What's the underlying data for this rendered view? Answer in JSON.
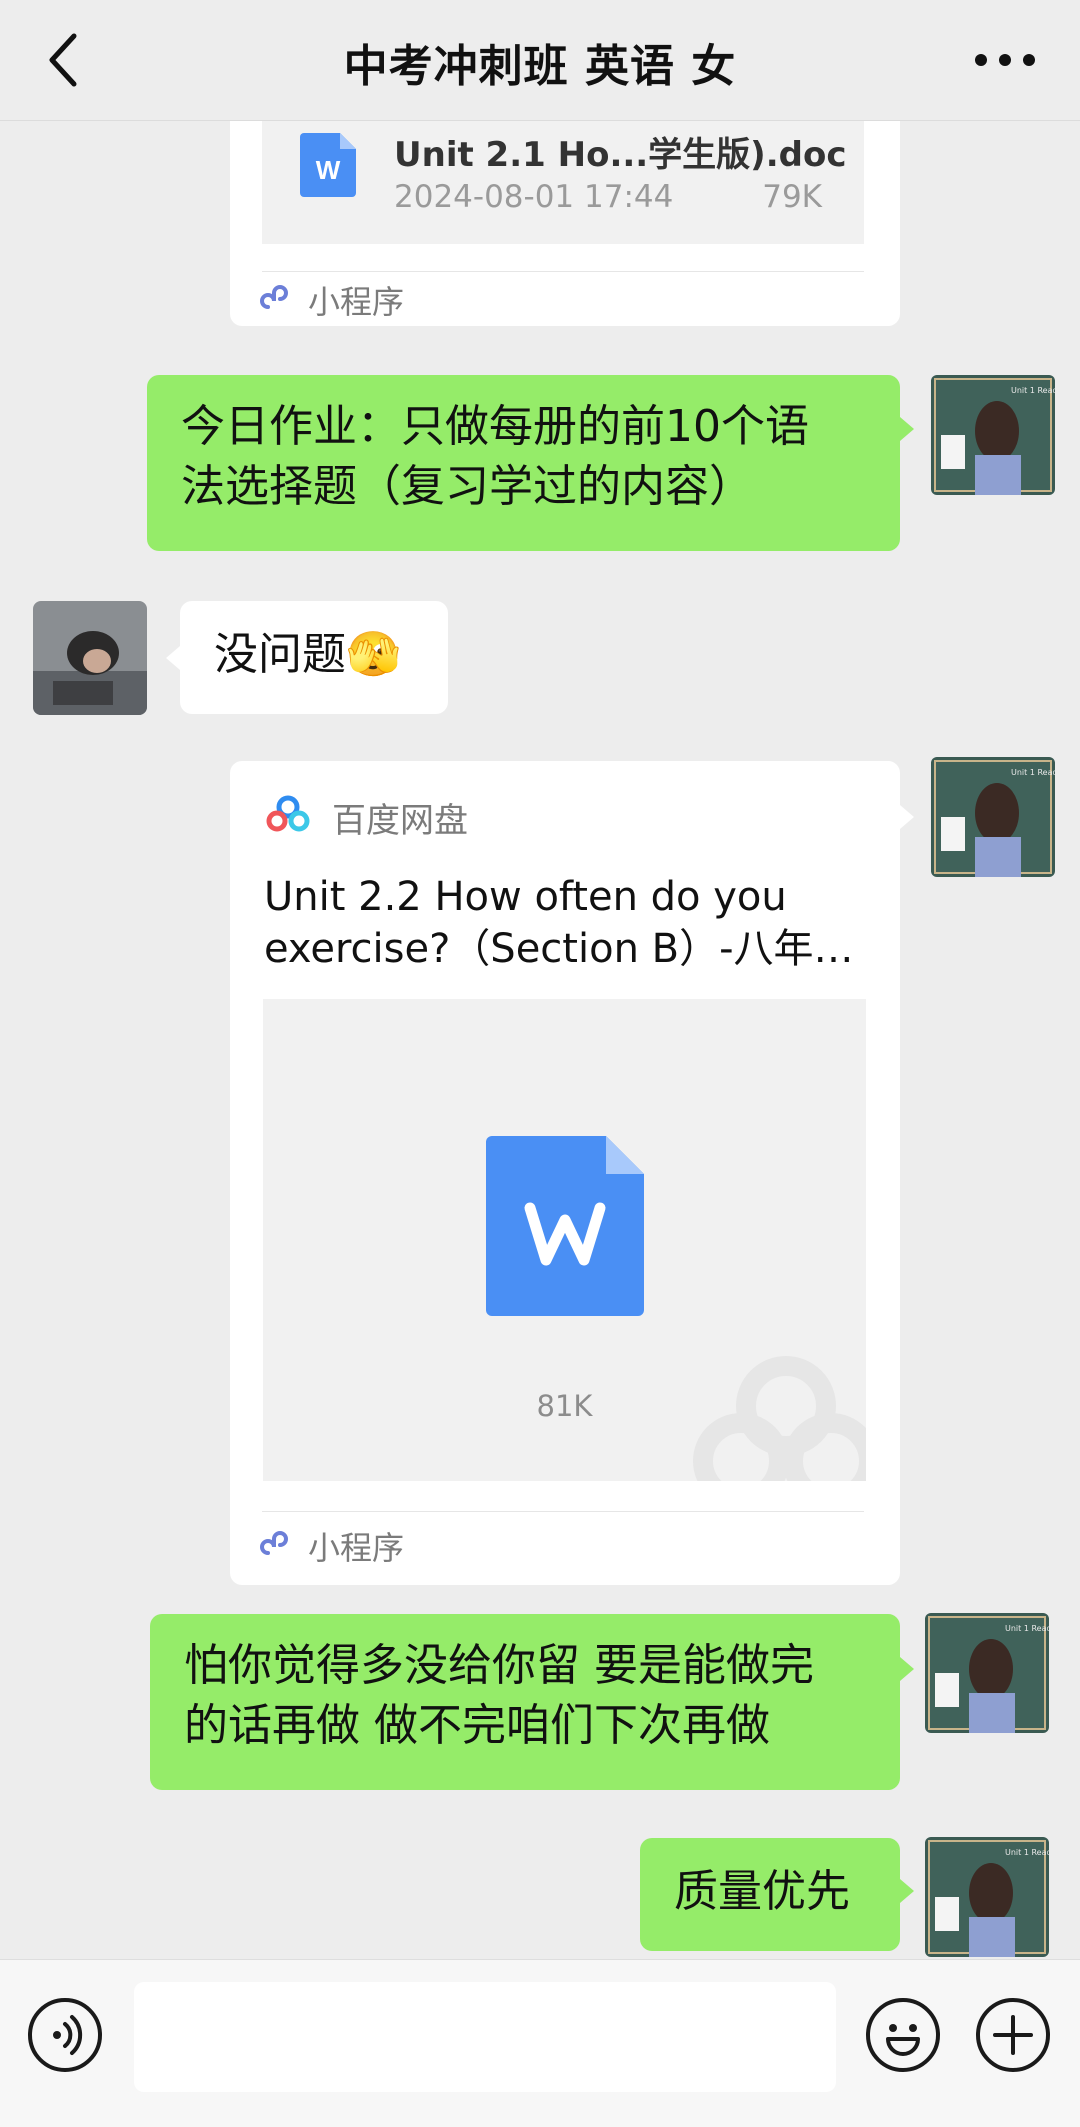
{
  "header": {
    "title": "中考冲刺班 英语 女"
  },
  "messages": {
    "file_card_1": {
      "file_name": "Unit 2.1 Ho...学生版).doc",
      "date": "2024-08-01 17:44",
      "size": "79K",
      "app_label": "小程序"
    },
    "text_1": {
      "line1": "今日作业：只做每册的前10个语",
      "line2": "法选择题（复习学过的内容）"
    },
    "reply_1": {
      "text": "没问题🫣"
    },
    "file_card_2": {
      "source": "百度网盘",
      "title_line1": "Unit 2.2 How often do you",
      "title_line2": "exercise?（Section B）-八年…",
      "size": "81K",
      "app_label": "小程序"
    },
    "text_2": {
      "line1": "怕你觉得多没给你留 要是能做完",
      "line2": "的话再做 做不完咱们下次再做"
    },
    "text_3": {
      "text": "质量优先"
    }
  },
  "colors": {
    "bubble_green": "#95ec69",
    "doc_blue": "#4a8ff4",
    "baidu_blue": "#2f8cf0"
  },
  "icons": [
    "back-icon",
    "more-icon",
    "voice-icon",
    "emoji-icon",
    "plus-icon",
    "word-doc-icon",
    "baidu-pan-icon",
    "mini-program-icon"
  ]
}
